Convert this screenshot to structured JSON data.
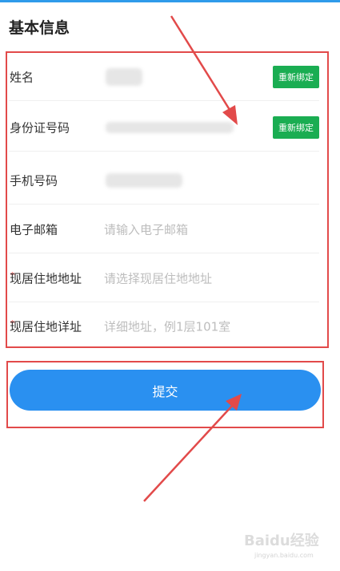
{
  "section": {
    "title": "基本信息"
  },
  "form": {
    "rows": [
      {
        "label": "姓名",
        "button": "重新绑定"
      },
      {
        "label": "身份证号码",
        "button": "重新绑定"
      },
      {
        "label": "手机号码"
      },
      {
        "label": "电子邮箱",
        "placeholder": "请输入电子邮箱"
      },
      {
        "label": "现居住地地址",
        "placeholder": "请选择现居住地地址",
        "required_mark": "*"
      },
      {
        "label": "现居住地详址",
        "placeholder": "详细地址，例1层101室",
        "required_mark": "*"
      }
    ]
  },
  "submit": {
    "label": "提交"
  },
  "watermark": {
    "text": "Baidu经验",
    "sub": "jingyan.baidu.com"
  },
  "colors": {
    "accent_blue": "#2a90f0",
    "rebind_green": "#1aad52",
    "annotation_red": "#e24a4a"
  }
}
